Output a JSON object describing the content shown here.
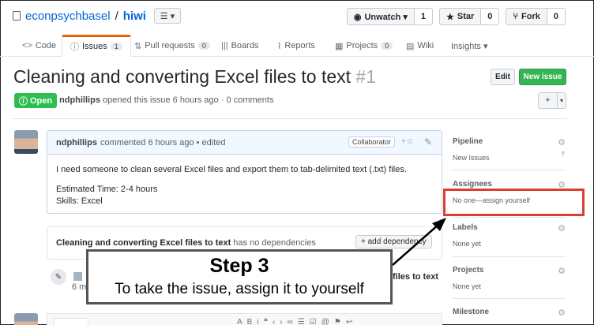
{
  "repo": {
    "owner": "econpsychbasel",
    "separator": "/",
    "name": "hiwi",
    "menu_label": "☰ ▾"
  },
  "actions": [
    {
      "label": "Unwatch ▾",
      "icon": "eye-icon",
      "count": "1"
    },
    {
      "label": "Star",
      "icon": "star-icon",
      "count": "0"
    },
    {
      "label": "Fork",
      "icon": "fork-icon",
      "count": "0"
    }
  ],
  "tabs": [
    {
      "label": "Code",
      "icon": "code-icon",
      "counter": ""
    },
    {
      "label": "Issues",
      "icon": "issue-icon",
      "counter": "1",
      "active": true
    },
    {
      "label": "Pull requests",
      "icon": "pull-request-icon",
      "counter": "0"
    },
    {
      "label": "Boards",
      "icon": "boards-icon",
      "counter": ""
    },
    {
      "label": "Reports",
      "icon": "reports-icon",
      "counter": ""
    },
    {
      "label": "Projects",
      "icon": "projects-icon",
      "counter": "0"
    },
    {
      "label": "Wiki",
      "icon": "wiki-icon",
      "counter": ""
    },
    {
      "label": "Insights ▾",
      "icon": "",
      "counter": ""
    }
  ],
  "issue": {
    "title": "Cleaning and converting Excel files to text",
    "number": "#1",
    "status": "Open",
    "author": "ndphillips",
    "meta_rest": "opened this issue 6 hours ago · 0 comments",
    "edit_label": "Edit",
    "new_issue_label": "New issue",
    "pin_glyph": "✦",
    "pin_caret": "▾"
  },
  "comment": {
    "author": "ndphillips",
    "meta": "commented 6 hours ago • edited",
    "badge": "Collaborator",
    "emoji": "+☺",
    "body_line1": "I need someone to clean several Excel files and export them to tab-delimited text (.txt) files.",
    "body_line2": "Estimated Time: 2-4 hours",
    "body_line3": "Skills: Excel"
  },
  "dependency": {
    "issue_title": "Cleaning and converting Excel files to text",
    "rest": "has no dependencies",
    "button": "+ add dependency"
  },
  "timeline": {
    "time_fragment": "6 m",
    "right_fragment": "files to text"
  },
  "sidebar": {
    "pipeline": {
      "heading": "Pipeline",
      "value": "New Issues"
    },
    "assignees": {
      "heading": "Assignees",
      "value": "No one—assign yourself"
    },
    "labels": {
      "heading": "Labels",
      "value": "None yet"
    },
    "projects": {
      "heading": "Projects",
      "value": "None yet"
    },
    "milestone": {
      "heading": "Milestone",
      "value": ""
    }
  },
  "overlay": {
    "heading": "Step 3",
    "text": "To take the issue, assign it to yourself"
  },
  "colors": {
    "highlight": "#d9412e",
    "link": "#0366d6",
    "open_green": "#2cbe4e",
    "tab_accent": "#e36209"
  }
}
